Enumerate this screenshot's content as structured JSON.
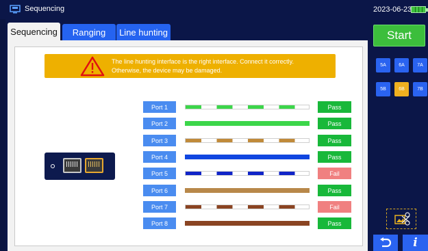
{
  "titlebar": {
    "app_icon": "monitor-icon",
    "title": "Sequencing",
    "date": "2023-06-23",
    "battery_icon": "battery-icon"
  },
  "tabs": [
    {
      "label": "Sequencing",
      "active": true
    },
    {
      "label": "Ranging",
      "active": false
    },
    {
      "label": "Line hunting",
      "active": false
    }
  ],
  "warning": {
    "icon": "warning-icon",
    "line1": "The line hunting interface is the right interface. Connect it correctly.",
    "line2": "Otherwise, the device may be damaged."
  },
  "ports": [
    {
      "label": "Port 1",
      "result": "Pass",
      "wire": "striped",
      "color": "#3cd64a"
    },
    {
      "label": "Port 2",
      "result": "Pass",
      "wire": "solid",
      "color": "#3cd64a"
    },
    {
      "label": "Port 3",
      "result": "Pass",
      "wire": "striped",
      "color": "#c08a3a"
    },
    {
      "label": "Port 4",
      "result": "Pass",
      "wire": "solid",
      "color": "#1046e0"
    },
    {
      "label": "Port 5",
      "result": "Fail",
      "wire": "striped",
      "color": "#1024c8"
    },
    {
      "label": "Port 6",
      "result": "Pass",
      "wire": "solid",
      "color": "#b8884a"
    },
    {
      "label": "Port 7",
      "result": "Fail",
      "wire": "striped",
      "color": "#8a4422"
    },
    {
      "label": "Port 8",
      "result": "Pass",
      "wire": "solid",
      "color": "#8a4422"
    }
  ],
  "sidebar": {
    "start_label": "Start",
    "channels_row1": [
      "5A",
      "6A",
      "7A"
    ],
    "channels_row2": [
      "5B",
      "6B",
      "7B"
    ],
    "active_channel": "6B",
    "image_icon": "image-swap-icon",
    "back_icon": "back-arrow-icon",
    "info_label": "i"
  },
  "colors": {
    "accent_blue": "#2563f0",
    "pass_green": "#18b83a",
    "fail_red": "#f08080",
    "warning_amber": "#eeb000"
  }
}
